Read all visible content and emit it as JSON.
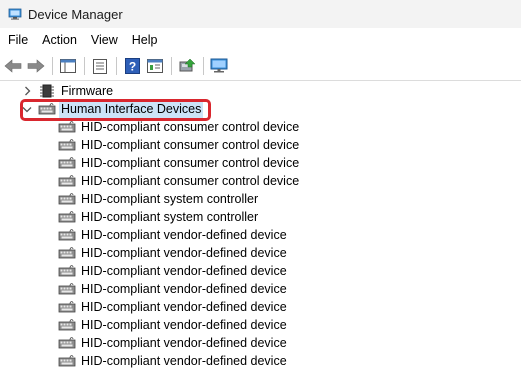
{
  "window": {
    "title": "Device Manager"
  },
  "menu": {
    "items": [
      "File",
      "Action",
      "View",
      "Help"
    ]
  },
  "toolbar": {
    "buttons": [
      {
        "name": "back-button",
        "icon": "arrow-left-icon"
      },
      {
        "name": "forward-button",
        "icon": "arrow-right-icon"
      },
      {
        "name": "show-hide-console-tree-button",
        "icon": "console-tree-icon"
      },
      {
        "name": "properties-button",
        "icon": "properties-icon"
      },
      {
        "name": "help-button",
        "icon": "help-icon"
      },
      {
        "name": "action-pane-button",
        "icon": "action-pane-icon"
      },
      {
        "name": "update-driver-button",
        "icon": "update-driver-icon"
      },
      {
        "name": "scan-hardware-button",
        "icon": "monitor-icon"
      }
    ]
  },
  "tree": {
    "firmware": "Firmware",
    "hid_category": "Human Interface Devices",
    "hid_devices": [
      "HID-compliant consumer control device",
      "HID-compliant consumer control device",
      "HID-compliant consumer control device",
      "HID-compliant consumer control device",
      "HID-compliant system controller",
      "HID-compliant system controller",
      "HID-compliant vendor-defined device",
      "HID-compliant vendor-defined device",
      "HID-compliant vendor-defined device",
      "HID-compliant vendor-defined device",
      "HID-compliant vendor-defined device",
      "HID-compliant vendor-defined device",
      "HID-compliant vendor-defined device",
      "HID-compliant vendor-defined device"
    ]
  },
  "colors": {
    "highlight": "#d9272e",
    "selection": "#cce4f7"
  }
}
